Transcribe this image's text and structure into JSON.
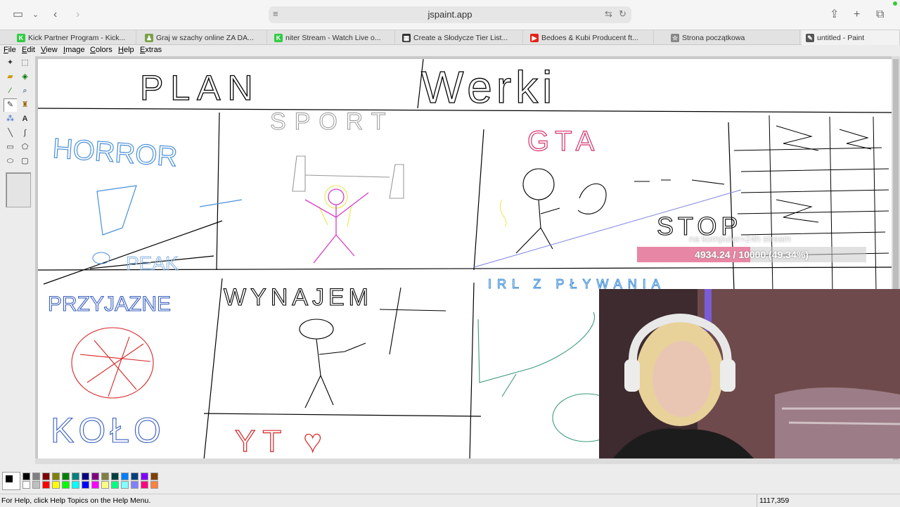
{
  "browser": {
    "url": "jspaint.app"
  },
  "tabs": [
    {
      "label": "Kick Partner Program - Kick...",
      "fav_color": "#2ecc40",
      "fav_glyph": "K"
    },
    {
      "label": "Graj w szachy online ZA DA...",
      "fav_color": "#7aa04a",
      "fav_glyph": "♟"
    },
    {
      "label": "niter Stream - Watch Live o...",
      "fav_color": "#2ecc40",
      "fav_glyph": "K"
    },
    {
      "label": "Create a Słodycze Tier List...",
      "fav_color": "#333333",
      "fav_glyph": "▦"
    },
    {
      "label": "Bedoes & Kubi Producent ft...",
      "fav_color": "#e62117",
      "fav_glyph": "▶"
    },
    {
      "label": "Strona początkowa",
      "fav_color": "#888888",
      "fav_glyph": "☆"
    },
    {
      "label": "untitled - Paint",
      "fav_color": "#555555",
      "fav_glyph": "✎"
    }
  ],
  "menu": [
    "File",
    "Edit",
    "View",
    "Image",
    "Colors",
    "Help",
    "Extras"
  ],
  "drawing": {
    "title_left": "PLAN",
    "title_right": "Werki",
    "cells": [
      "HORROR",
      "SPORT",
      "GTA",
      "PRZYJAZNE",
      "WYNAJEM",
      "IRL Z PŁYWANIA",
      "KOŁO",
      "YT ♥"
    ],
    "cell_extra": [
      "PEAK",
      "STOP"
    ]
  },
  "overlay": {
    "label": "na komputer=24h stream",
    "progress_text": "4934.24 / 10000 (49.34%)",
    "progress_fraction": 0.4934
  },
  "palette": [
    "#000000",
    "#808080",
    "#800000",
    "#808000",
    "#008000",
    "#008080",
    "#000080",
    "#800080",
    "#808040",
    "#004040",
    "#0080ff",
    "#004080",
    "#8000ff",
    "#804000",
    "#ffffff",
    "#c0c0c0",
    "#ff0000",
    "#ffff00",
    "#00ff00",
    "#00ffff",
    "#0000ff",
    "#ff00ff",
    "#ffff80",
    "#00ff80",
    "#80ffff",
    "#8080ff",
    "#ff0080",
    "#ff8040"
  ],
  "status": {
    "help": "For Help, click Help Topics on the Help Menu.",
    "coords": "1117,359"
  }
}
